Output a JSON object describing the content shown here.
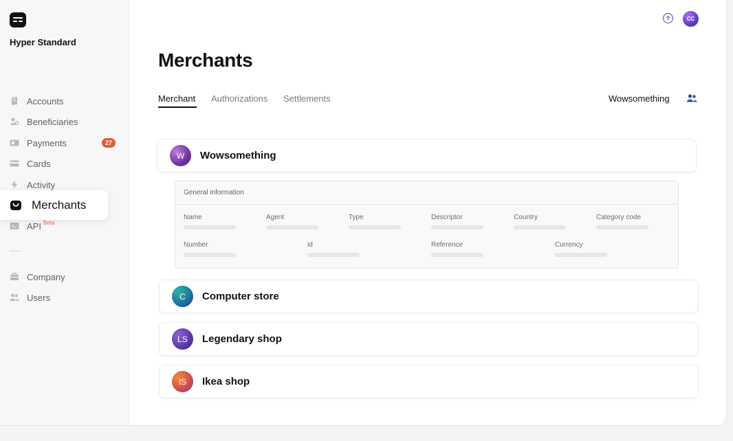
{
  "brand": {
    "name": "Hyper Standard"
  },
  "sidebar": {
    "items": [
      {
        "label": "Accounts",
        "icon": "accounts-icon"
      },
      {
        "label": "Beneficiaries",
        "icon": "beneficiaries-icon"
      },
      {
        "label": "Payments",
        "icon": "payments-icon",
        "badge": "27"
      },
      {
        "label": "Cards",
        "icon": "cards-icon"
      },
      {
        "label": "Activity",
        "icon": "lightning-icon"
      },
      {
        "label": "Merchants",
        "icon": "bag-icon",
        "active": true
      },
      {
        "label": "API",
        "icon": "api-icon",
        "sup": "Beta"
      },
      {
        "label": "Company",
        "icon": "company-icon"
      },
      {
        "label": "Users",
        "icon": "users-icon"
      }
    ]
  },
  "header": {
    "help_icon": "?",
    "avatar_initials": "CC"
  },
  "page": {
    "title": "Merchants"
  },
  "tabs": [
    {
      "label": "Merchant",
      "active": true
    },
    {
      "label": "Authorizations"
    },
    {
      "label": "Settlements"
    }
  ],
  "selected_merchant": {
    "label": "Wowsomething"
  },
  "merchants": [
    {
      "name": "Wowsomething",
      "initials": "W",
      "expanded": true
    },
    {
      "name": "Computer store",
      "initials": "C"
    },
    {
      "name": "Legendary shop",
      "initials": "LS"
    },
    {
      "name": "Ikea shop",
      "initials": "IS"
    }
  ],
  "general_info": {
    "title": "General information",
    "row1": [
      "Name",
      "Agent",
      "Type",
      "Descriptor",
      "Country",
      "Category code"
    ],
    "row2": [
      "Number",
      "id",
      "Reference",
      "Currency"
    ]
  },
  "colors": {
    "accent": "#3b4a9c",
    "badge": "#e05c3a",
    "beta": "#e86a43"
  }
}
